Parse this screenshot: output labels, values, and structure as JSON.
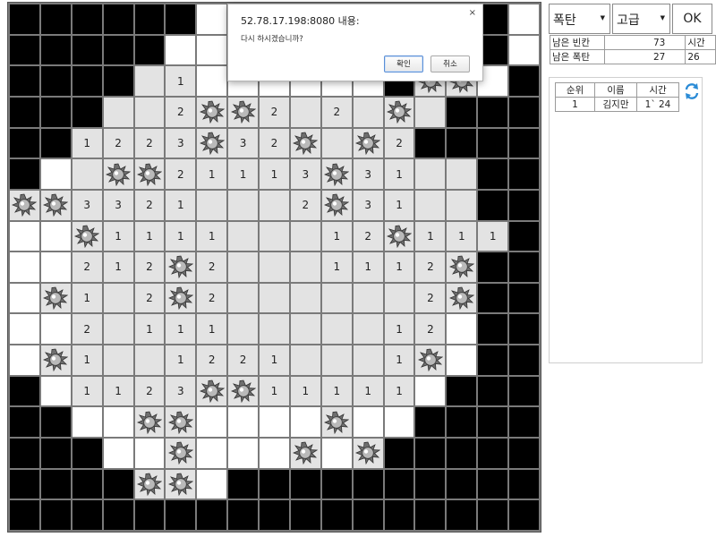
{
  "controls": {
    "type_select": "폭탄",
    "level_select": "고급",
    "ok_label": "OK"
  },
  "stats": {
    "remaining_cells_label": "남은 빈칸",
    "remaining_cells": "73",
    "remaining_bombs_label": "남은 폭탄",
    "remaining_bombs": "27",
    "time_label": "시간",
    "time": "26"
  },
  "ranking": {
    "headers": [
      "순위",
      "이름",
      "시간"
    ],
    "rows": [
      {
        "rank": "1",
        "name": "김지만",
        "time": "1` 24"
      }
    ],
    "refresh_icon": "refresh-icon"
  },
  "dialog": {
    "title": "52.78.17.198:8080 내용:",
    "message": "다시 하시겠습니까?",
    "ok_label": "확인",
    "cancel_label": "취소",
    "close_glyph": "×"
  },
  "board": {
    "rows": 17,
    "cols": 17,
    "legend": "#=hidden F=white-unopened O=opened-empty M=mine digit=number",
    "grid": [
      "######?#####W###?",
      "#####FWFWFWFFFM#F",
      "####O1FFFFFF#MMF#",
      "###OO2MM2O2OMO###",
      "##1223M32MOM2####",
      "#FOMM21113M31OO##",
      "MM3321OOO2M31OO##",
      "FFM1111OOO12M111#",
      "FF212M2OOO1112M##",
      "FM1O2M2OOOOOO2M##",
      "FF2O111OOOOO12F##",
      "FM1OO1221OOO1MF##",
      "#F1123MM11111F###",
      "##FFMMFFFFMFF####",
      "###FFMFFFMFM#####",
      "####MMF##########",
      "#################"
    ]
  },
  "colors": {
    "hidden": "#000000",
    "opened": "#e3e3e3",
    "unopened_white": "#ffffff",
    "grid_line": "#7a7a7a",
    "refresh_icon": "#2a8bd6"
  }
}
